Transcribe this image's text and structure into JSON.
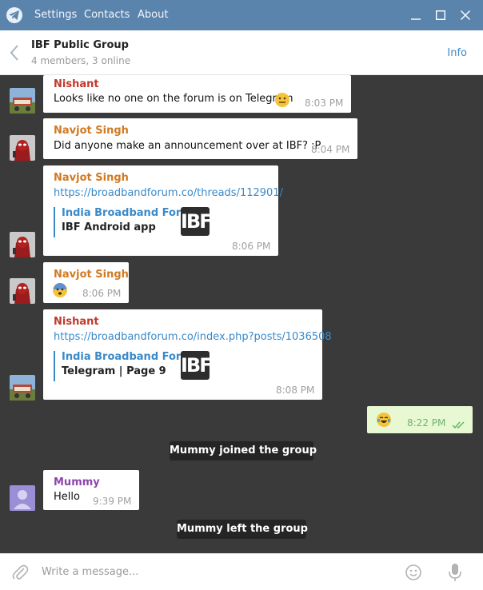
{
  "titlebar": {
    "menu": [
      "Settings",
      "Contacts",
      "About"
    ]
  },
  "header": {
    "title": "IBF Public Group",
    "subtitle": "4 members, 3 online",
    "info": "Info"
  },
  "messages": [
    {
      "sender": "Nishant",
      "text": "Looks like no one on the forum is on Telegram",
      "time": "8:03 PM"
    },
    {
      "sender": "Navjot Singh",
      "text": "Did anyone make an announcement over at IBF? :P",
      "time": "8:04 PM"
    },
    {
      "sender": "Navjot Singh",
      "link": "https://broadbandforum.co/threads/112901/",
      "preview_site": "India Broadband Forum",
      "preview_title": "IBF Android app",
      "time": "8:06 PM"
    },
    {
      "sender": "Navjot Singh",
      "time": "8:06 PM"
    },
    {
      "sender": "Nishant",
      "link": "https://broadbandforum.co/index.php?posts/1036508",
      "preview_site": "India Broadband Forum",
      "preview_title": "Telegram | Page 9",
      "time": "8:08 PM"
    },
    {
      "time": "8:22 PM"
    },
    {
      "service": "Mummy joined the group"
    },
    {
      "sender": "Mummy",
      "text": "Hello",
      "time": "9:39 PM"
    },
    {
      "service": "Mummy left the group"
    }
  ],
  "preview_logo": "IBF",
  "input": {
    "placeholder": "Write a message..."
  },
  "colors": {
    "titlebar": "#5b84ad",
    "chat_bg": "#3a3a3a",
    "link": "#3a8ac9",
    "sender_nishant": "#c0392b",
    "sender_navjot": "#d17a22",
    "sender_mummy": "#8e44ad",
    "outgoing_bubble": "#e7f8d3"
  },
  "icons": [
    "telegram-logo-icon",
    "minimize-icon",
    "maximize-icon",
    "close-icon",
    "back-arrow-icon",
    "paperclip-icon",
    "smile-icon",
    "microphone-icon",
    "double-check-icon",
    "neutral-face-emoji",
    "fearful-face-emoji",
    "tears-of-joy-emoji"
  ]
}
